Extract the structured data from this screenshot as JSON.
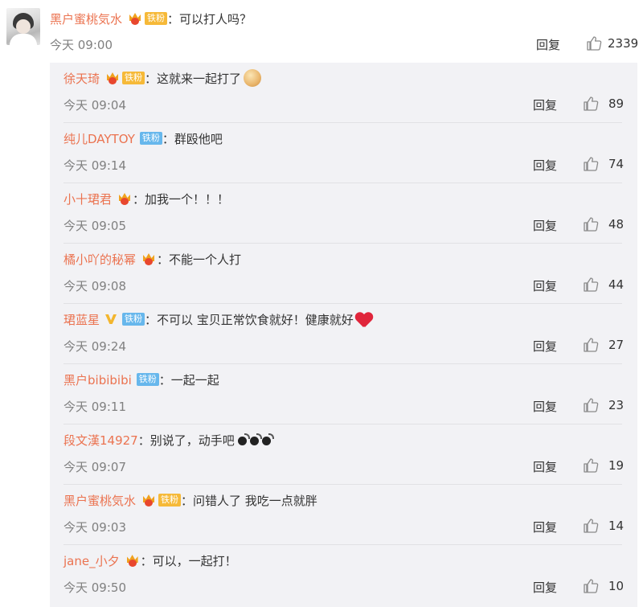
{
  "main": {
    "username": "黑户蜜桃気水",
    "badge": "铁粉",
    "colon": "：",
    "text": "可以打人吗？",
    "time": "今天 09:00",
    "reply_label": "回复",
    "likes": "2339"
  },
  "replies": [
    {
      "username": "徐天琦",
      "badge": "铁粉",
      "text": "这就来一起打了",
      "time": "今天 09:04",
      "likes": "89"
    },
    {
      "username": "纯儿DAYTOY",
      "badge": "铁粉",
      "text": "群殴他吧",
      "time": "今天 09:14",
      "likes": "74"
    },
    {
      "username": "小十珺君",
      "text": "加我一个！！！",
      "time": "今天 09:05",
      "likes": "48"
    },
    {
      "username": "橘小吖的秘幂",
      "text": "不能一个人打",
      "time": "今天 09:08",
      "likes": "44"
    },
    {
      "username": "珺蓝星",
      "badge": "铁粉",
      "text": "不可以 宝贝正常饮食就好！健康就好",
      "time": "今天 09:24",
      "likes": "27"
    },
    {
      "username": "黑户bibibibi",
      "badge": "铁粉",
      "text": "一起一起",
      "time": "今天 09:11",
      "likes": "23"
    },
    {
      "username": "段文漢14927",
      "text": "别说了，动手吧",
      "time": "今天 09:07",
      "likes": "19"
    },
    {
      "username": "黑户蜜桃気水",
      "badge": "铁粉",
      "text": "问错人了  我吃一点就胖",
      "time": "今天 09:03",
      "likes": "14"
    },
    {
      "username": "jane_小夕",
      "text": "可以，一起打！",
      "time": "今天 09:50",
      "likes": "10"
    }
  ],
  "colors": {
    "username": "#eb7350",
    "text": "#333333",
    "meta": "#808080",
    "reply_bg": "#f2f2f5",
    "badge_gold": "#f6b938",
    "badge_blue": "#67b7ec"
  },
  "icons": {
    "like": "thumbs-up-icon",
    "crown": "crown-icon",
    "verified": "verified-v-icon",
    "heart": "heart-icon",
    "bomb": "bomb-icon",
    "emoji": "clap-emoji-icon"
  }
}
